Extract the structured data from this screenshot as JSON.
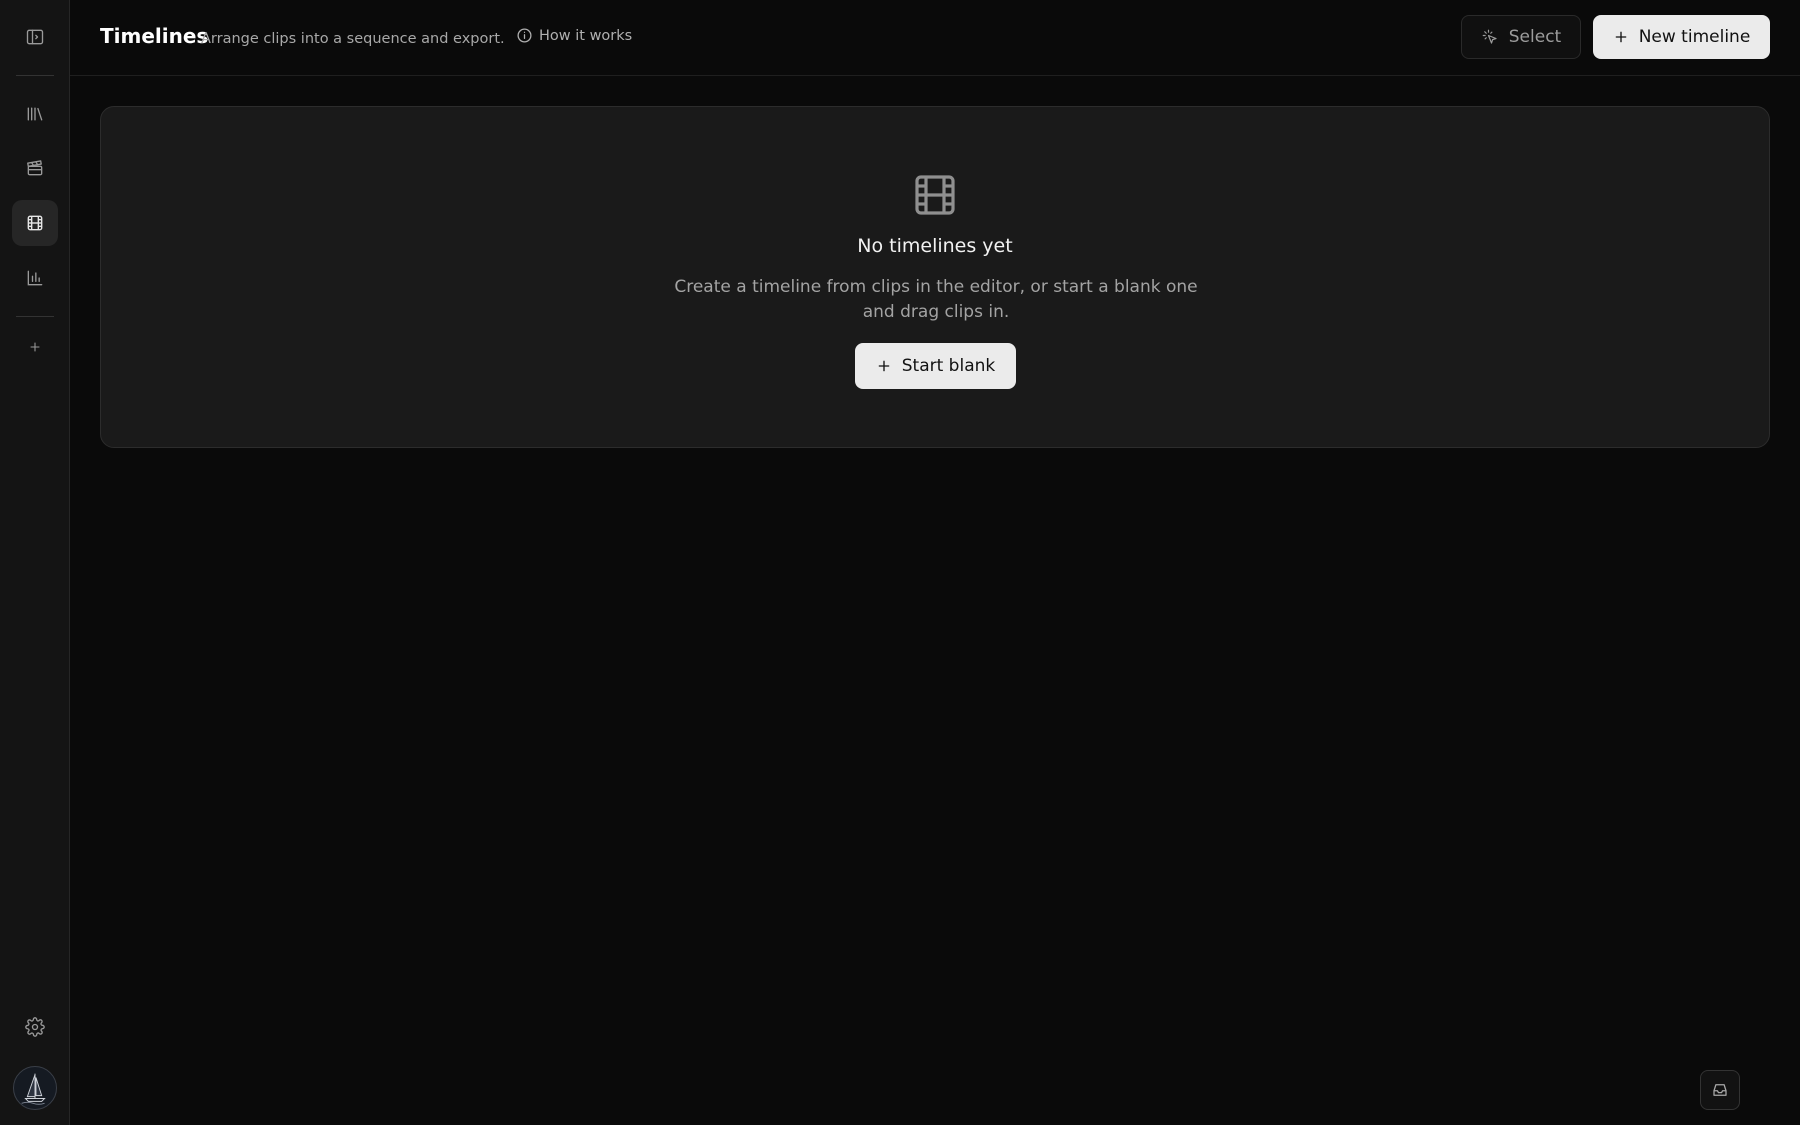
{
  "header": {
    "title": "Timelines",
    "subtitle": "Arrange clips into a sequence and export.",
    "help_link": "How it works",
    "select_label": "Select",
    "new_label": "New timeline"
  },
  "sidebar": {
    "items": [
      {
        "icon": "sidebar-toggle-icon"
      },
      {
        "icon": "library-icon"
      },
      {
        "icon": "clapperboard-icon"
      },
      {
        "icon": "film-icon",
        "active": true
      },
      {
        "icon": "bar-chart-icon"
      },
      {
        "icon": "plus-icon"
      },
      {
        "icon": "gear-icon"
      }
    ]
  },
  "empty_state": {
    "title": "No timelines yet",
    "description": "Create a timeline from clips in the editor, or start a blank one and drag clips in.",
    "button_label": "Start blank"
  },
  "colors": {
    "background": "#0a0a0a",
    "sidebar": "#141414",
    "card": "#1a1a1a",
    "primary_button": "#ebebeb"
  }
}
